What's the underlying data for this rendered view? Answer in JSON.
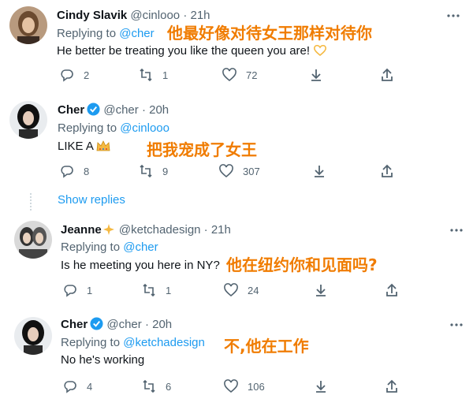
{
  "tweets": [
    {
      "name": "Cindy Slavik",
      "handle": "@cinlooo",
      "sep": "·",
      "time": "21h",
      "replying_prefix": "Replying to ",
      "replying_to": "@cher",
      "text": "He better be treating you like the queen you are!",
      "emoji": "heart-hands",
      "translation": "他最好像对待女王那样对待你",
      "replies": "2",
      "retweets": "1",
      "likes": "72"
    },
    {
      "name": "Cher",
      "verified": true,
      "handle": "@cher",
      "sep": "·",
      "time": "20h",
      "replying_prefix": "Replying to ",
      "replying_to": "@cinlooo",
      "text": "LIKE A",
      "emoji": "crown",
      "translation": "把我宠成了女王",
      "replies": "8",
      "retweets": "9",
      "likes": "307"
    },
    {
      "name": "Jeanne",
      "emoji_name": "sparkle-star",
      "handle": "@ketchadesign",
      "sep": "·",
      "time": "21h",
      "replying_prefix": "Replying to ",
      "replying_to": "@cher",
      "text": "Is he meeting you here in NY?",
      "translation": "他在纽约你和见面吗?",
      "replies": "1",
      "retweets": "1",
      "likes": "24"
    },
    {
      "name": "Cher",
      "verified": true,
      "handle": "@cher",
      "sep": "·",
      "time": "20h",
      "replying_prefix": "Replying to ",
      "replying_to": "@ketchadesign",
      "text": "No he's working",
      "translation": "不,他在工作",
      "replies": "4",
      "retweets": "6",
      "likes": "106"
    }
  ],
  "show_replies": "Show replies",
  "colors": {
    "link": "#1d9bf0",
    "meta": "#536471",
    "translation": "#f07c00",
    "verified": "#1d9bf0"
  }
}
